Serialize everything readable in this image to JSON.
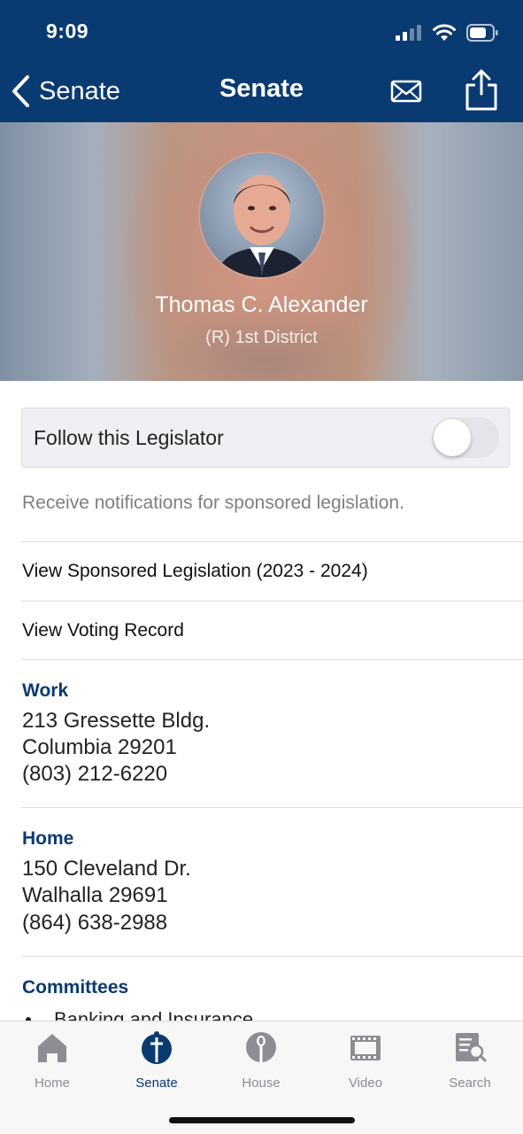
{
  "status_bar": {
    "time": "9:09"
  },
  "nav": {
    "back_label": "Senate",
    "title": "Senate"
  },
  "icons": {
    "back": "chevron-left-icon",
    "mail": "mail-icon",
    "share": "share-icon",
    "signal": "cellular-signal-icon",
    "wifi": "wifi-icon",
    "battery": "battery-icon"
  },
  "legislator": {
    "name": "Thomas C. Alexander",
    "district": "(R) 1st District"
  },
  "follow": {
    "label": "Follow this Legislator",
    "enabled": false,
    "note": "Receive notifications for sponsored legislation."
  },
  "links": [
    {
      "label": "View Sponsored Legislation (2023 - 2024)"
    },
    {
      "label": "View Voting Record"
    }
  ],
  "work": {
    "title": "Work",
    "address_line1": "213 Gressette Bldg.",
    "address_line2": "Columbia 29201",
    "phone": "(803) 212-6220"
  },
  "home": {
    "title": "Home",
    "address_line1": "150 Cleveland Dr.",
    "address_line2": "Walhalla 29691",
    "phone": "(864) 638-2988"
  },
  "committees": {
    "title": "Committees",
    "items": [
      "Banking and Insurance"
    ]
  },
  "tabbar": {
    "active": "Senate",
    "tabs": [
      {
        "label": "Home",
        "icon": "home-icon"
      },
      {
        "label": "Senate",
        "icon": "senate-icon"
      },
      {
        "label": "House",
        "icon": "house-icon"
      },
      {
        "label": "Video",
        "icon": "video-icon"
      },
      {
        "label": "Search",
        "icon": "search-icon"
      }
    ]
  },
  "colors": {
    "brand": "#0a3a72",
    "tab_inactive": "#8c8e93",
    "muted_text": "#7d7f84"
  }
}
